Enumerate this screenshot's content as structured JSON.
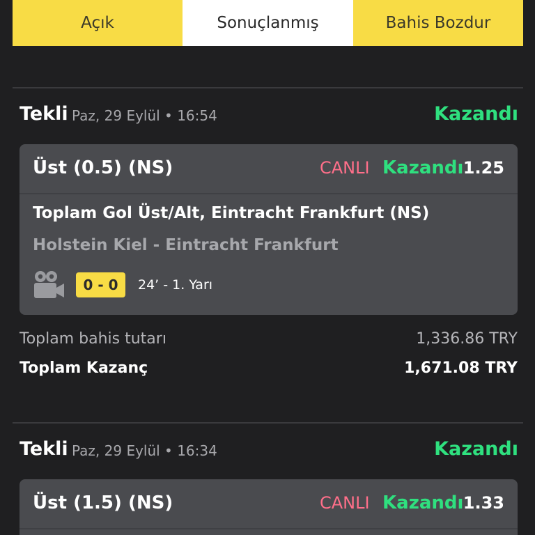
{
  "tabs": [
    {
      "label": "Açık",
      "active": false
    },
    {
      "label": "Sonuçlanmış",
      "active": true
    },
    {
      "label": "Bahis Bozdur",
      "active": false
    }
  ],
  "colors": {
    "tab_bg": "#f8dc45",
    "tab_active_bg": "#ffffff",
    "win_green": "#2fe07f",
    "live_pink": "#ff6f8a",
    "card_bg": "#4a4b4f",
    "page_bg": "#1f1f21"
  },
  "bets": [
    {
      "type": "Tekli",
      "date": "Paz, 29 Eylül • 16:54",
      "status": "Kazandı",
      "selection": "Üst (0.5) (NS)",
      "live_label": "CANLI",
      "result": "Kazandı",
      "odds": "1.25",
      "market": "Toplam Gol Üst/Alt, Eintracht Frankfurt (NS)",
      "teams": "Holstein Kiel - Eintracht Frankfurt",
      "icon": "video-camera-icon",
      "score": "0 - 0",
      "minute": "24’ - 1. Yarı",
      "stake_label": "Toplam bahis tutarı",
      "stake_value": "1,336.86 TRY",
      "win_label": "Toplam Kazanç",
      "win_value": "1,671.08 TRY"
    },
    {
      "type": "Tekli",
      "date": "Paz, 29 Eylül • 16:34",
      "status": "Kazandı",
      "selection": "Üst (1.5) (NS)",
      "live_label": "CANLI",
      "result": "Kazandı",
      "odds": "1.33"
    }
  ]
}
